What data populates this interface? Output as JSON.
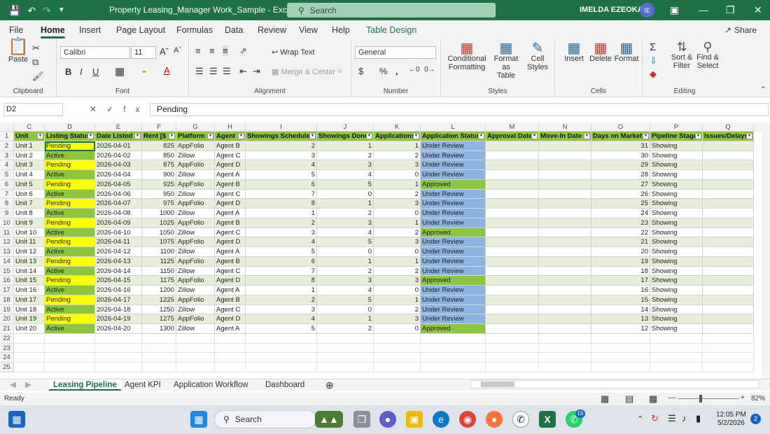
{
  "titlebar": {
    "title": "Property Leasing_Manager Work_Sample  -  Excel",
    "search_placeholder": "Search",
    "user": "IMELDA EZEOKA",
    "initials": "IE"
  },
  "ribbon_tabs": [
    "File",
    "Home",
    "Insert",
    "Page Layout",
    "Formulas",
    "Data",
    "Review",
    "View",
    "Help",
    "Table Design"
  ],
  "share_label": "Share",
  "ribbon": {
    "clipboard": {
      "label": "Clipboard",
      "paste": "Paste"
    },
    "font": {
      "label": "Font",
      "name": "Calibri",
      "size": "11"
    },
    "alignment": {
      "label": "Alignment",
      "wrap": "Wrap Text",
      "merge": "Merge & Center"
    },
    "number": {
      "label": "Number",
      "format": "General"
    },
    "styles": {
      "label": "Styles",
      "cond_1": "Conditional",
      "cond_2": "Formatting",
      "fmt_table_1": "Format as",
      "fmt_table_2": "Table",
      "cell_styles_1": "Cell",
      "cell_styles_2": "Styles"
    },
    "cells": {
      "label": "Cells",
      "insert": "Insert",
      "delete": "Delete",
      "format": "Format"
    },
    "editing": {
      "label": "Editing",
      "sort_1": "Sort &",
      "sort_2": "Filter",
      "find_1": "Find &",
      "find_2": "Select"
    }
  },
  "formula_bar": {
    "name_box": "D2",
    "content": "Pending",
    "fx": "fx"
  },
  "columns": [
    "C",
    "D",
    "E",
    "F",
    "G",
    "H",
    "I",
    "J",
    "K",
    "L",
    "M",
    "N",
    "O",
    "P",
    "Q"
  ],
  "headers": [
    "Unit",
    "Listing Status",
    "Date Listed",
    "Rent [$",
    "Platform",
    "Agent",
    "Showings Scheduled",
    "Showings Done",
    "Applications",
    "Application Status",
    "Approval Date",
    "Move-In Date",
    "Days on Market",
    "Pipeline Stage",
    "Issues/Delays"
  ],
  "rows": [
    [
      "Unit 1",
      "Pending",
      "2026-04-01",
      "825",
      "AppFolio",
      "Agent B",
      "2",
      "1",
      "1",
      "Under Review",
      "",
      "",
      "31",
      "Showing",
      ""
    ],
    [
      "Unit 2",
      "Active",
      "2026-04-02",
      "850",
      "Zillow",
      "Agent C",
      "3",
      "2",
      "2",
      "Under Review",
      "",
      "",
      "30",
      "Showing",
      ""
    ],
    [
      "Unit 3",
      "Pending",
      "2026-04-03",
      "875",
      "AppFolio",
      "Agent D",
      "4",
      "3",
      "3",
      "Under Review",
      "",
      "",
      "29",
      "Showing",
      ""
    ],
    [
      "Unit 4",
      "Active",
      "2026-04-04",
      "900",
      "Zillow",
      "Agent A",
      "5",
      "4",
      "0",
      "Under Review",
      "",
      "",
      "28",
      "Showing",
      ""
    ],
    [
      "Unit 5",
      "Pending",
      "2026-04-05",
      "925",
      "AppFolio",
      "Agent B",
      "6",
      "5",
      "1",
      "Approved",
      "",
      "",
      "27",
      "Showing",
      ""
    ],
    [
      "Unit 6",
      "Active",
      "2026-04-06",
      "950",
      "Zillow",
      "Agent C",
      "7",
      "0",
      "2",
      "Under Review",
      "",
      "",
      "26",
      "Showing",
      ""
    ],
    [
      "Unit 7",
      "Pending",
      "2026-04-07",
      "975",
      "AppFolio",
      "Agent D",
      "8",
      "1",
      "3",
      "Under Review",
      "",
      "",
      "25",
      "Showing",
      ""
    ],
    [
      "Unit 8",
      "Active",
      "2026-04-08",
      "1000",
      "Zillow",
      "Agent A",
      "1",
      "2",
      "0",
      "Under Review",
      "",
      "",
      "24",
      "Showing",
      ""
    ],
    [
      "Unit 9",
      "Pending",
      "2026-04-09",
      "1025",
      "AppFolio",
      "Agent B",
      "2",
      "3",
      "1",
      "Under Review",
      "",
      "",
      "23",
      "Showing",
      ""
    ],
    [
      "Unit 10",
      "Active",
      "2026-04-10",
      "1050",
      "Zillow",
      "Agent C",
      "3",
      "4",
      "2",
      "Approved",
      "",
      "",
      "22",
      "Showing",
      ""
    ],
    [
      "Unit 11",
      "Pending",
      "2026-04-11",
      "1075",
      "AppFolio",
      "Agent D",
      "4",
      "5",
      "3",
      "Under Review",
      "",
      "",
      "21",
      "Showing",
      ""
    ],
    [
      "Unit 12",
      "Active",
      "2026-04-12",
      "1100",
      "Zillow",
      "Agent A",
      "5",
      "0",
      "0",
      "Under Review",
      "",
      "",
      "20",
      "Showing",
      ""
    ],
    [
      "Unit 13",
      "Pending",
      "2026-04-13",
      "1125",
      "AppFolio",
      "Agent B",
      "6",
      "1",
      "1",
      "Under Review",
      "",
      "",
      "19",
      "Showing",
      ""
    ],
    [
      "Unit 14",
      "Active",
      "2026-04-14",
      "1150",
      "Zillow",
      "Agent C",
      "7",
      "2",
      "2",
      "Under Review",
      "",
      "",
      "18",
      "Showing",
      ""
    ],
    [
      "Unit 15",
      "Pending",
      "2026-04-15",
      "1175",
      "AppFolio",
      "Agent D",
      "8",
      "3",
      "3",
      "Approved",
      "",
      "",
      "17",
      "Showing",
      ""
    ],
    [
      "Unit 16",
      "Active",
      "2026-04-16",
      "1200",
      "Zillow",
      "Agent A",
      "1",
      "4",
      "0",
      "Under Review",
      "",
      "",
      "16",
      "Showing",
      ""
    ],
    [
      "Unit 17",
      "Pending",
      "2026-04-17",
      "1225",
      "AppFolio",
      "Agent B",
      "2",
      "5",
      "1",
      "Under Review",
      "",
      "",
      "15",
      "Showing",
      ""
    ],
    [
      "Unit 18",
      "Active",
      "2026-04-18",
      "1250",
      "Zillow",
      "Agent C",
      "3",
      "0",
      "2",
      "Under Review",
      "",
      "",
      "14",
      "Showing",
      ""
    ],
    [
      "Unit 19",
      "Pending",
      "2026-04-19",
      "1275",
      "AppFolio",
      "Agent D",
      "4",
      "1",
      "3",
      "Under Review",
      "",
      "",
      "13",
      "Showing",
      ""
    ],
    [
      "Unit 20",
      "Active",
      "2026-04-20",
      "1300",
      "Zillow",
      "Agent A",
      "5",
      "2",
      "0",
      "Approved",
      "",
      "",
      "12",
      "Showing",
      ""
    ]
  ],
  "row_numbers": [
    "1",
    "2",
    "3",
    "4",
    "5",
    "6",
    "7",
    "8",
    "9",
    "10",
    "11",
    "12",
    "13",
    "14",
    "15",
    "16",
    "17",
    "18",
    "19",
    "20",
    "21",
    "22",
    "23",
    "24",
    "25"
  ],
  "sheet_tabs": [
    "Leasing Pipeline",
    "Agent KPI",
    "Application Workflow",
    "Dashboard"
  ],
  "status": {
    "ready": "Ready",
    "zoom": "82%"
  },
  "taskbar": {
    "search": "Search",
    "time": "12:05 PM",
    "date": "5/2/2026",
    "whatsapp_badge": "15",
    "notif": "2"
  },
  "colors": {
    "excel_green": "#1e7145",
    "header_green": "#8cc63e",
    "pending_yellow": "#ffff00",
    "review_blue": "#8db4e2",
    "band": "#e7efda"
  }
}
